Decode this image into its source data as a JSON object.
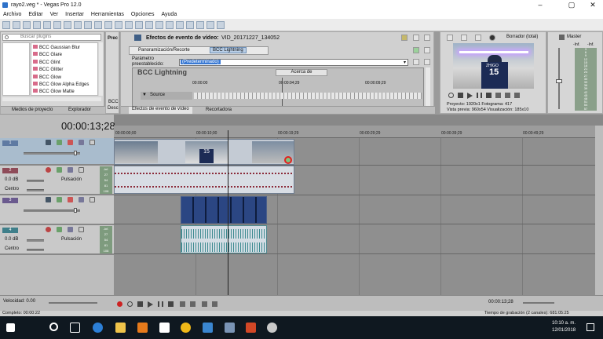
{
  "window": {
    "title": "rayo2.veg * - Vegas Pro 12.0",
    "min": "–",
    "max": "▢",
    "close": "✕"
  },
  "menu": [
    "Archivo",
    "Editar",
    "Ver",
    "Insertar",
    "Herramientas",
    "Opciones",
    "Ayuda"
  ],
  "plugins": {
    "search_placeholder": "Buscar plugins",
    "items": [
      "BCC Gaussian Blur",
      "BCC Glare",
      "BCC Glint",
      "BCC Glitter",
      "BCC Glow",
      "BCC Glow Alpha Edges",
      "BCC Glow Matte"
    ],
    "tabs": [
      "Medios de proyecto",
      "Explorador"
    ],
    "side_labels": [
      "Prec",
      "BCC",
      "Desc"
    ]
  },
  "fx": {
    "title": "Efectos de evento de vídeo:",
    "clip_name": "VID_20171227_134052",
    "chain": [
      "Panoramización/Recorte",
      "BCC Lightning"
    ],
    "preset_label": "Parámetro preestablecido:",
    "preset_value": "(Predeterminado)",
    "plugin_header": "BCC Lightning",
    "about": "Acerca de",
    "times": [
      "00:00:00",
      "00:00:04;29",
      "00:00:09;29"
    ],
    "row_label": "Source",
    "tabs": [
      "Efectos de evento de vídeo",
      "Recortadora"
    ]
  },
  "preview": {
    "mode": "Borrador (total)",
    "project_label": "Proyecto:",
    "project_val": "1920x1",
    "frame_label": "Fotograma:",
    "frame_val": "417",
    "preview_label": "Vista previa:",
    "preview_val": "960x54",
    "display_label": "Visualización:",
    "display_val": "185x10",
    "jersey_name": "ZHIGO",
    "jersey_num": "15"
  },
  "master": {
    "label": "Master",
    "db": "-Inf.",
    "db2": "-Inf.",
    "ticks": [
      "3",
      "6",
      "9",
      "12",
      "15",
      "18",
      "21",
      "24",
      "27",
      "30",
      "33",
      "36",
      "39",
      "42",
      "45",
      "48",
      "51",
      "54",
      "57"
    ]
  },
  "timeline": {
    "timecode": "00:00:13;28",
    "ruler": [
      "00:00:00;00",
      "00:00:10;00",
      "00:00:19;29",
      "00:00:29;29",
      "00:00:39;29",
      "00:00:49;29"
    ],
    "tracks": [
      {
        "num": "1",
        "type": "video"
      },
      {
        "num": "2",
        "type": "audio",
        "vol": "0.0 dB",
        "pan": "Centro",
        "mode": "Pulsación",
        "meter": [
          "-Inf.",
          "27",
          "54",
          "81",
          "108"
        ]
      },
      {
        "num": "3",
        "type": "video"
      },
      {
        "num": "4",
        "type": "audio",
        "vol": "0.0 dB",
        "pan": "Centro",
        "mode": "Pulsación",
        "meter": [
          "-Inf.",
          "27",
          "54",
          "81",
          "108"
        ]
      }
    ],
    "clip_num": "15"
  },
  "transport": {
    "rate": "Velocidad: 0.00",
    "timecode": "00:00:13;28",
    "status": "Completo: 00:00:22",
    "record": "Tiempo de grabación (2 canales): 681:05:25"
  },
  "taskbar": {
    "time": "10:10 a. m.",
    "date": "12/01/2018"
  }
}
